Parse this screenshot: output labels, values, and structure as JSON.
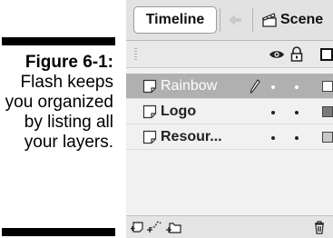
{
  "caption": {
    "figure_label": "Figure 6-1:",
    "text": "Flash keeps you organized by listing all your layers."
  },
  "panel": {
    "tab_label": "Timeline",
    "scene_label": "Scene",
    "header_icons": [
      "eye-icon",
      "lock-icon",
      "outline-icon"
    ],
    "layers": [
      {
        "name": "Rainbow",
        "selected": true,
        "editing": true,
        "color": "#ffffff"
      },
      {
        "name": "Logo",
        "selected": false,
        "editing": false,
        "color": "#7a7a7a"
      },
      {
        "name": "Resour...",
        "selected": false,
        "editing": false,
        "color": "#c8c8c8"
      }
    ],
    "footer_icons": [
      "insert-layer-icon",
      "add-motion-guide-icon",
      "insert-layer-folder-icon",
      "delete-layer-icon"
    ]
  },
  "colors": {
    "selected_row": "#b0b0b0",
    "panel_bg": "#e6e6e6"
  }
}
